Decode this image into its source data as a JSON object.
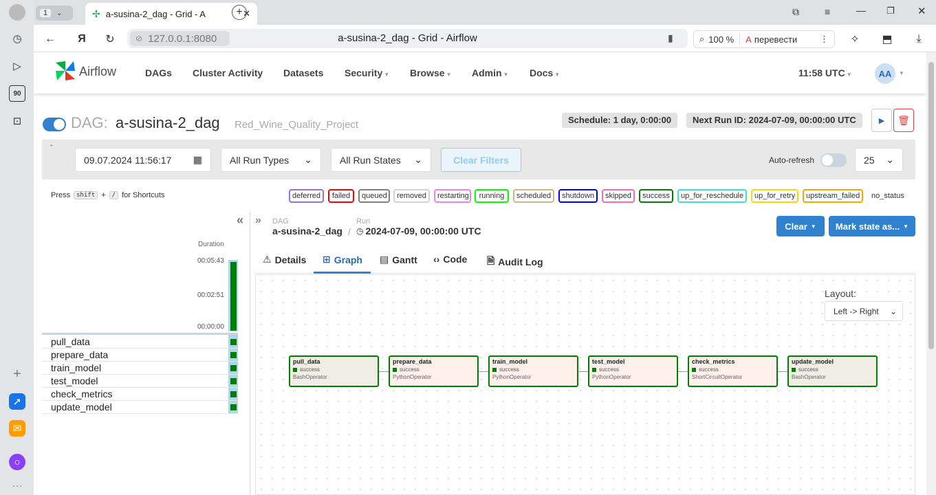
{
  "browser": {
    "tab_count": "1",
    "tab_title": "a-susina-2_dag - Grid - A",
    "address": "127.0.0.1:8080",
    "page_title": "a-susina-2_dag - Grid - Airflow",
    "zoom": "100 %",
    "translate_label": "перевести"
  },
  "sidebar": {
    "badge": "90"
  },
  "nav": {
    "brand": "Airflow",
    "items": [
      "DAGs",
      "Cluster Activity",
      "Datasets",
      "Security",
      "Browse",
      "Admin",
      "Docs"
    ],
    "time": "11:58 UTC",
    "user_initials": "AA"
  },
  "dag": {
    "prefix": "DAG:",
    "id": "a-susina-2_dag",
    "tag": "Red_Wine_Quality_Project",
    "schedule": "Schedule: 1 day, 0:00:00",
    "next_run": "Next Run ID: 2024-07-09, 00:00:00 UTC"
  },
  "filters": {
    "date": "09.07.2024 11:56:17",
    "run_types": "All Run Types",
    "run_states": "All Run States",
    "clear_filters": "Clear Filters",
    "auto_refresh": "Auto-refresh",
    "page_size": "25"
  },
  "shortcuts": {
    "press": "Press",
    "key1": "shift",
    "plus": "+",
    "key2": "/",
    "suffix": "for Shortcuts"
  },
  "legend": [
    {
      "label": "deferred",
      "color": "#9370db"
    },
    {
      "label": "failed",
      "color": "#ff0000"
    },
    {
      "label": "queued",
      "color": "#808080"
    },
    {
      "label": "removed",
      "color": "#d3d3d3"
    },
    {
      "label": "restarting",
      "color": "#ee82ee"
    },
    {
      "label": "running",
      "color": "#00ff00"
    },
    {
      "label": "scheduled",
      "color": "#d2b48c"
    },
    {
      "label": "shutdown",
      "color": "#0000ff"
    },
    {
      "label": "skipped",
      "color": "#ff69b4"
    },
    {
      "label": "success",
      "color": "#008000"
    },
    {
      "label": "up_for_reschedule",
      "color": "#40e0d0"
    },
    {
      "label": "up_for_retry",
      "color": "#ffd700"
    },
    {
      "label": "upstream_failed",
      "color": "#ffa500"
    },
    {
      "label": "no_status",
      "color": "#ffffff"
    }
  ],
  "grid": {
    "duration_label": "Duration",
    "ticks": [
      "00:05:43",
      "00:02:51",
      "00:00:00"
    ],
    "tasks": [
      "pull_data",
      "prepare_data",
      "train_model",
      "test_model",
      "check_metrics",
      "update_model"
    ]
  },
  "run": {
    "dag_label": "DAG",
    "dag_id": "a-susina-2_dag",
    "sep": "/",
    "run_label": "Run",
    "run_id": "2024-07-09, 00:00:00 UTC",
    "clear": "Clear",
    "mark_state": "Mark state as..."
  },
  "tabs": [
    "Details",
    "Graph",
    "Gantt",
    "Code",
    "Audit Log"
  ],
  "graph": {
    "layout_label": "Layout:",
    "layout_value": "Left -> Right",
    "nodes": [
      {
        "id": "pull_data",
        "state": "success",
        "op": "BashOperator"
      },
      {
        "id": "prepare_data",
        "state": "success",
        "op": "PythonOperator"
      },
      {
        "id": "train_model",
        "state": "success",
        "op": "PythonOperator"
      },
      {
        "id": "test_model",
        "state": "success",
        "op": "PythonOperator"
      },
      {
        "id": "check_metrics",
        "state": "success",
        "op": "ShortCircuitOperator"
      },
      {
        "id": "update_model",
        "state": "success",
        "op": "BashOperator"
      }
    ]
  }
}
